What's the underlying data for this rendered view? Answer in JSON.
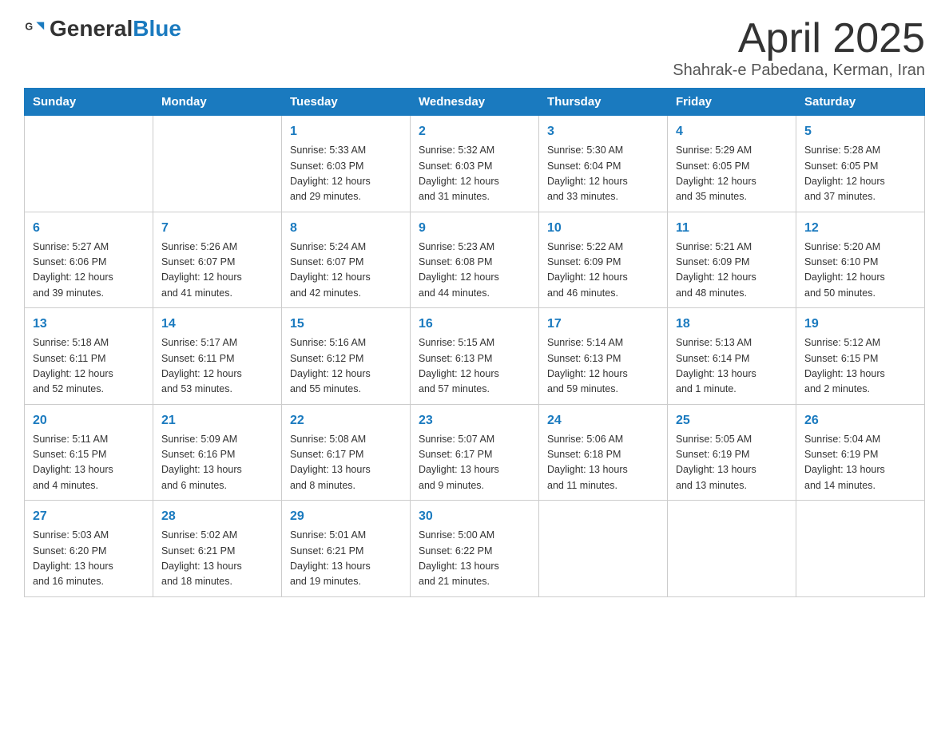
{
  "header": {
    "logo_general": "General",
    "logo_blue": "Blue",
    "month_title": "April 2025",
    "subtitle": "Shahrak-e Pabedana, Kerman, Iran"
  },
  "weekdays": [
    "Sunday",
    "Monday",
    "Tuesday",
    "Wednesday",
    "Thursday",
    "Friday",
    "Saturday"
  ],
  "rows": [
    [
      {
        "day": "",
        "detail": ""
      },
      {
        "day": "",
        "detail": ""
      },
      {
        "day": "1",
        "detail": "Sunrise: 5:33 AM\nSunset: 6:03 PM\nDaylight: 12 hours\nand 29 minutes."
      },
      {
        "day": "2",
        "detail": "Sunrise: 5:32 AM\nSunset: 6:03 PM\nDaylight: 12 hours\nand 31 minutes."
      },
      {
        "day": "3",
        "detail": "Sunrise: 5:30 AM\nSunset: 6:04 PM\nDaylight: 12 hours\nand 33 minutes."
      },
      {
        "day": "4",
        "detail": "Sunrise: 5:29 AM\nSunset: 6:05 PM\nDaylight: 12 hours\nand 35 minutes."
      },
      {
        "day": "5",
        "detail": "Sunrise: 5:28 AM\nSunset: 6:05 PM\nDaylight: 12 hours\nand 37 minutes."
      }
    ],
    [
      {
        "day": "6",
        "detail": "Sunrise: 5:27 AM\nSunset: 6:06 PM\nDaylight: 12 hours\nand 39 minutes."
      },
      {
        "day": "7",
        "detail": "Sunrise: 5:26 AM\nSunset: 6:07 PM\nDaylight: 12 hours\nand 41 minutes."
      },
      {
        "day": "8",
        "detail": "Sunrise: 5:24 AM\nSunset: 6:07 PM\nDaylight: 12 hours\nand 42 minutes."
      },
      {
        "day": "9",
        "detail": "Sunrise: 5:23 AM\nSunset: 6:08 PM\nDaylight: 12 hours\nand 44 minutes."
      },
      {
        "day": "10",
        "detail": "Sunrise: 5:22 AM\nSunset: 6:09 PM\nDaylight: 12 hours\nand 46 minutes."
      },
      {
        "day": "11",
        "detail": "Sunrise: 5:21 AM\nSunset: 6:09 PM\nDaylight: 12 hours\nand 48 minutes."
      },
      {
        "day": "12",
        "detail": "Sunrise: 5:20 AM\nSunset: 6:10 PM\nDaylight: 12 hours\nand 50 minutes."
      }
    ],
    [
      {
        "day": "13",
        "detail": "Sunrise: 5:18 AM\nSunset: 6:11 PM\nDaylight: 12 hours\nand 52 minutes."
      },
      {
        "day": "14",
        "detail": "Sunrise: 5:17 AM\nSunset: 6:11 PM\nDaylight: 12 hours\nand 53 minutes."
      },
      {
        "day": "15",
        "detail": "Sunrise: 5:16 AM\nSunset: 6:12 PM\nDaylight: 12 hours\nand 55 minutes."
      },
      {
        "day": "16",
        "detail": "Sunrise: 5:15 AM\nSunset: 6:13 PM\nDaylight: 12 hours\nand 57 minutes."
      },
      {
        "day": "17",
        "detail": "Sunrise: 5:14 AM\nSunset: 6:13 PM\nDaylight: 12 hours\nand 59 minutes."
      },
      {
        "day": "18",
        "detail": "Sunrise: 5:13 AM\nSunset: 6:14 PM\nDaylight: 13 hours\nand 1 minute."
      },
      {
        "day": "19",
        "detail": "Sunrise: 5:12 AM\nSunset: 6:15 PM\nDaylight: 13 hours\nand 2 minutes."
      }
    ],
    [
      {
        "day": "20",
        "detail": "Sunrise: 5:11 AM\nSunset: 6:15 PM\nDaylight: 13 hours\nand 4 minutes."
      },
      {
        "day": "21",
        "detail": "Sunrise: 5:09 AM\nSunset: 6:16 PM\nDaylight: 13 hours\nand 6 minutes."
      },
      {
        "day": "22",
        "detail": "Sunrise: 5:08 AM\nSunset: 6:17 PM\nDaylight: 13 hours\nand 8 minutes."
      },
      {
        "day": "23",
        "detail": "Sunrise: 5:07 AM\nSunset: 6:17 PM\nDaylight: 13 hours\nand 9 minutes."
      },
      {
        "day": "24",
        "detail": "Sunrise: 5:06 AM\nSunset: 6:18 PM\nDaylight: 13 hours\nand 11 minutes."
      },
      {
        "day": "25",
        "detail": "Sunrise: 5:05 AM\nSunset: 6:19 PM\nDaylight: 13 hours\nand 13 minutes."
      },
      {
        "day": "26",
        "detail": "Sunrise: 5:04 AM\nSunset: 6:19 PM\nDaylight: 13 hours\nand 14 minutes."
      }
    ],
    [
      {
        "day": "27",
        "detail": "Sunrise: 5:03 AM\nSunset: 6:20 PM\nDaylight: 13 hours\nand 16 minutes."
      },
      {
        "day": "28",
        "detail": "Sunrise: 5:02 AM\nSunset: 6:21 PM\nDaylight: 13 hours\nand 18 minutes."
      },
      {
        "day": "29",
        "detail": "Sunrise: 5:01 AM\nSunset: 6:21 PM\nDaylight: 13 hours\nand 19 minutes."
      },
      {
        "day": "30",
        "detail": "Sunrise: 5:00 AM\nSunset: 6:22 PM\nDaylight: 13 hours\nand 21 minutes."
      },
      {
        "day": "",
        "detail": ""
      },
      {
        "day": "",
        "detail": ""
      },
      {
        "day": "",
        "detail": ""
      }
    ]
  ]
}
